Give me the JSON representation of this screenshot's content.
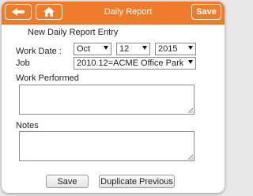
{
  "header": {
    "title": "Daily Report",
    "save_label": "Save"
  },
  "form": {
    "subtitle": "New Daily Report Entry",
    "work_date_label": "Work Date :",
    "month": "Oct",
    "day": "12",
    "year": "2015",
    "job_label": "Job",
    "job_value": "2010.12=ACME Office Park",
    "work_performed_label": "Work Performed",
    "notes_label": "Notes",
    "work_performed_value": "",
    "notes_value": ""
  },
  "footer": {
    "save_label": "Save",
    "duplicate_label": "Duplicate Previous"
  },
  "colors": {
    "accent": "#f07b2a"
  },
  "icons": {
    "back": "arrow-left-icon",
    "home": "home-icon"
  }
}
